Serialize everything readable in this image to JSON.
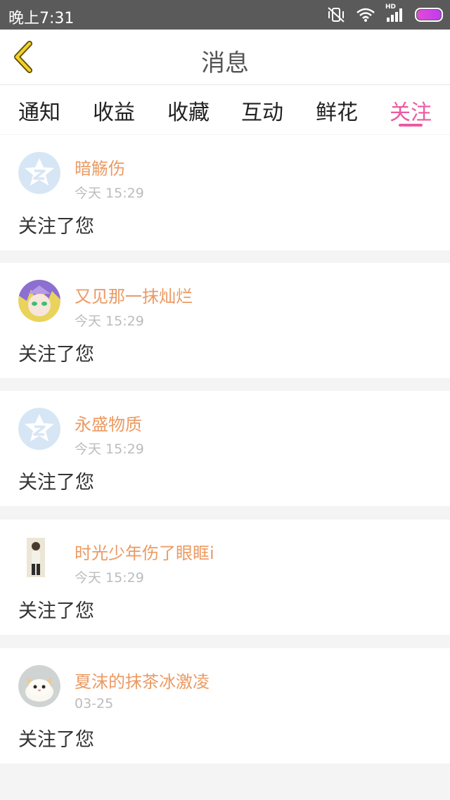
{
  "status_bar": {
    "time": "晚上7:31",
    "icons": [
      "vibrate-off-icon",
      "wifi-icon",
      "hd-signal-icon",
      "battery-icon"
    ],
    "hd_label": "HD"
  },
  "header": {
    "back_icon": "chevron-left-icon",
    "title": "消息"
  },
  "tabs": [
    {
      "label": "通知",
      "active": false
    },
    {
      "label": "收益",
      "active": false
    },
    {
      "label": "收藏",
      "active": false
    },
    {
      "label": "互动",
      "active": false
    },
    {
      "label": "鲜花",
      "active": false
    },
    {
      "label": "关注",
      "active": true
    }
  ],
  "notifications": [
    {
      "name": "暗觞伤",
      "time": "今天 15:29",
      "message": "关注了您",
      "avatar": "qzone-default-avatar"
    },
    {
      "name": "又见那一抹灿烂",
      "time": "今天 15:29",
      "message": "关注了您",
      "avatar": "anime-character-avatar"
    },
    {
      "name": "永盛物质",
      "time": "今天 15:29",
      "message": "关注了您",
      "avatar": "qzone-default-avatar"
    },
    {
      "name": "时光少年伤了眼眶i",
      "time": "今天 15:29",
      "message": "关注了您",
      "avatar": "person-photo-avatar"
    },
    {
      "name": "夏沫的抹茶冰激凌",
      "time": "03-25",
      "message": "关注了您",
      "avatar": "cat-photo-avatar"
    }
  ],
  "colors": {
    "accent": "#ec5aa0",
    "name": "#eb9a63",
    "status_bar": "#5a5a5a",
    "background": "#f4f4f4"
  }
}
